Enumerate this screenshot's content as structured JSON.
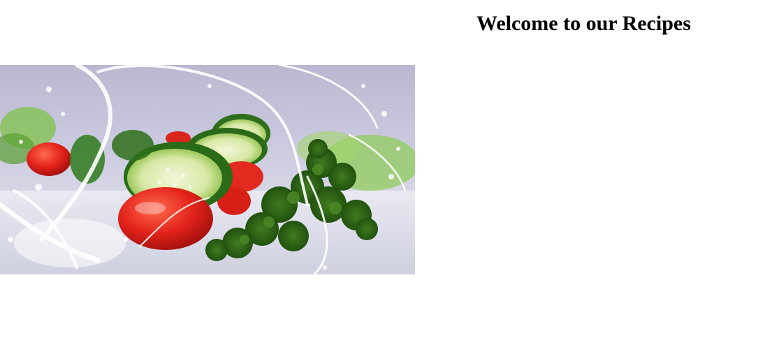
{
  "header": {
    "title": "Welcome to our Recipes"
  },
  "hero": {
    "icon": "salad-photo"
  }
}
